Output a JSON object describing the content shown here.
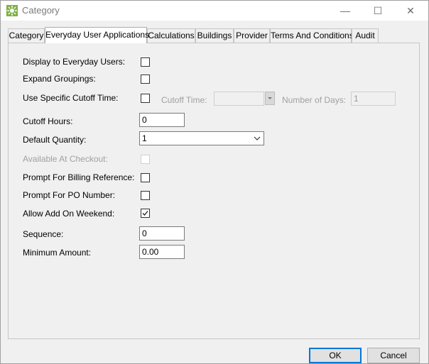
{
  "window": {
    "title": "Category",
    "minimize_glyph": "—",
    "maximize_glyph": "☐",
    "close_glyph": "✕"
  },
  "tabs": [
    {
      "label": "Category",
      "active": false
    },
    {
      "label": "Everyday User Applications",
      "active": true
    },
    {
      "label": "Calculations",
      "active": false
    },
    {
      "label": "Buildings",
      "active": false
    },
    {
      "label": "Provider",
      "active": false
    },
    {
      "label": "Terms And Conditions",
      "active": false
    },
    {
      "label": "Audit",
      "active": false
    }
  ],
  "form": {
    "display_everyday_label": "Display to Everyday Users:",
    "display_everyday_checked": false,
    "expand_groupings_label": "Expand Groupings:",
    "expand_groupings_checked": false,
    "use_cutoff_label": "Use Specific Cutoff Time:",
    "use_cutoff_checked": false,
    "cutoff_time_label": "Cutoff Time:",
    "cutoff_time_value": "",
    "number_of_days_label": "Number of Days:",
    "number_of_days_value": "1",
    "cutoff_hours_label": "Cutoff Hours:",
    "cutoff_hours_value": "0",
    "default_quantity_label": "Default Quantity:",
    "default_quantity_value": "1",
    "available_checkout_label": "Available At Checkout:",
    "available_checkout_checked": false,
    "prompt_billing_label": "Prompt For Billing Reference:",
    "prompt_billing_checked": false,
    "prompt_po_label": "Prompt For PO Number:",
    "prompt_po_checked": false,
    "allow_weekend_label": "Allow Add On Weekend:",
    "allow_weekend_checked": true,
    "sequence_label": "Sequence:",
    "sequence_value": "0",
    "minimum_amount_label": "Minimum Amount:",
    "minimum_amount_value": "0.00"
  },
  "buttons": {
    "ok": "OK",
    "cancel": "Cancel"
  },
  "colors": {
    "accent": "#0078d7",
    "app_icon": "#7cb342"
  }
}
